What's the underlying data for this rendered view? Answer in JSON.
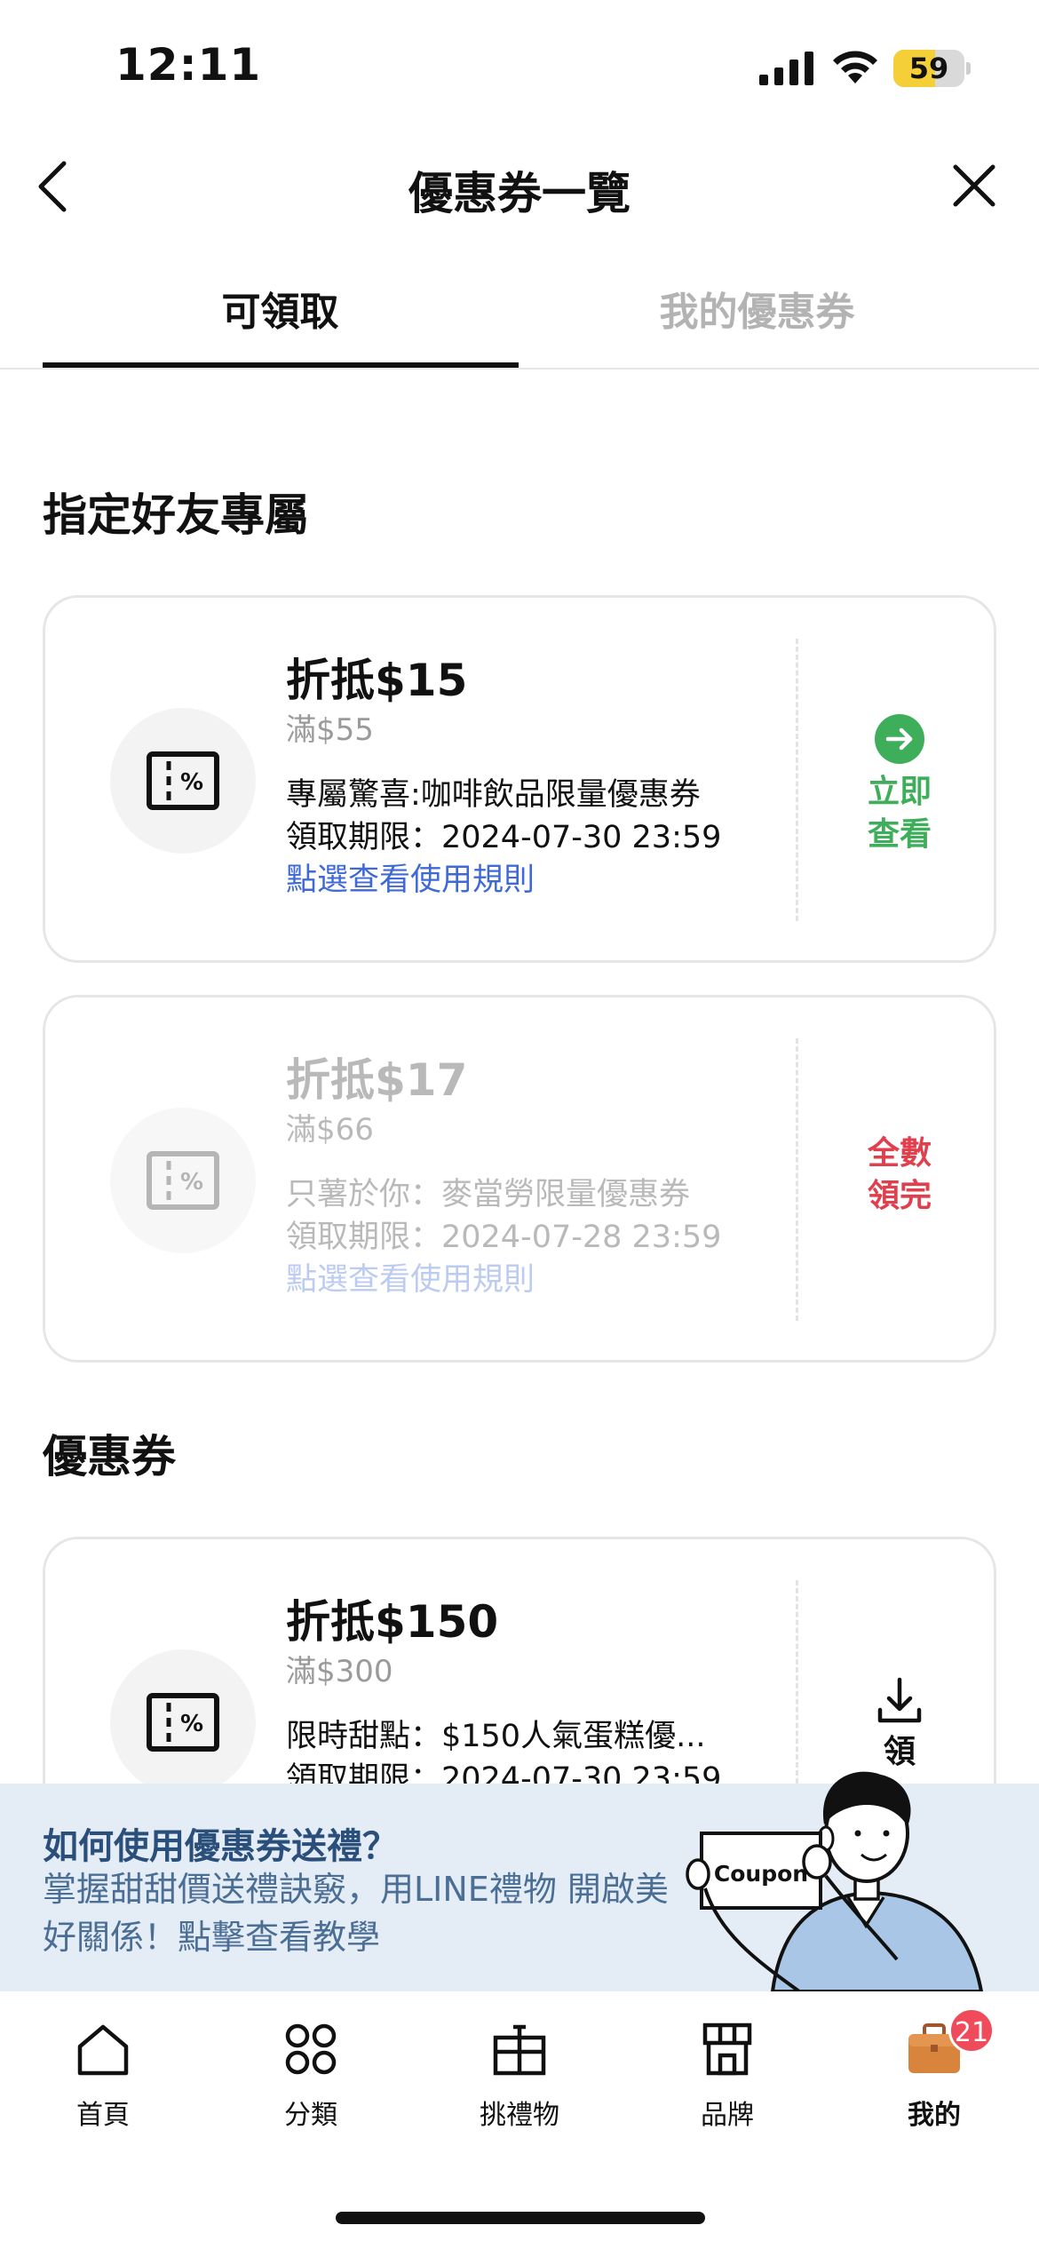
{
  "status_bar": {
    "time": "12:11",
    "battery_level": "59",
    "battery_color": "#f5cf38"
  },
  "header": {
    "title": "優惠券一覽",
    "back_icon": "chevron-left-icon",
    "close_icon": "close-icon"
  },
  "tabs": [
    {
      "label": "可領取",
      "active": true
    },
    {
      "label": "我的優惠券",
      "active": false
    }
  ],
  "sections": [
    {
      "title": "指定好友專屬",
      "coupons": [
        {
          "amount": "折抵$15",
          "minimum": "滿$55",
          "description": "專屬驚喜:咖啡飲品限量優惠券",
          "deadline": "領取期限：2024-07-30 23:59",
          "rules_link": "點選查看使用規則",
          "action_line1": "立即",
          "action_line2": "查看",
          "action_icon": "arrow-right-circle-icon",
          "action_color": "#3fae5b",
          "state": "available"
        },
        {
          "amount": "折抵$17",
          "minimum": "滿$66",
          "description": "只薯於你：麥當勞限量優惠券",
          "deadline": "領取期限：2024-07-28 23:59",
          "rules_link": "點選查看使用規則",
          "action_line1": "全數",
          "action_line2": "領完",
          "action_color": "#e0404d",
          "state": "sold-out"
        }
      ]
    },
    {
      "title": "優惠券",
      "coupons": [
        {
          "amount": "折抵$150",
          "minimum": "滿$300",
          "description": "限時甜點：$150人氣蛋糕優...",
          "deadline": "領取期限：2024-07-30 23:59",
          "action_icon": "download-icon",
          "action_line1": "領",
          "state": "downloadable"
        }
      ]
    }
  ],
  "promo_banner": {
    "title": "如何使用優惠券送禮？",
    "body": "掌握甜甜價送禮訣竅，用LINE禮物 開啟美好關係！點擊查看教學",
    "sign_text": "Coupon"
  },
  "bottom_nav": [
    {
      "label": "首頁",
      "icon": "home-icon"
    },
    {
      "label": "分類",
      "icon": "category-icon"
    },
    {
      "label": "挑禮物",
      "icon": "gift-icon"
    },
    {
      "label": "品牌",
      "icon": "store-icon"
    },
    {
      "label": "我的",
      "icon": "briefcase-icon",
      "badge": "21",
      "active": true
    }
  ]
}
